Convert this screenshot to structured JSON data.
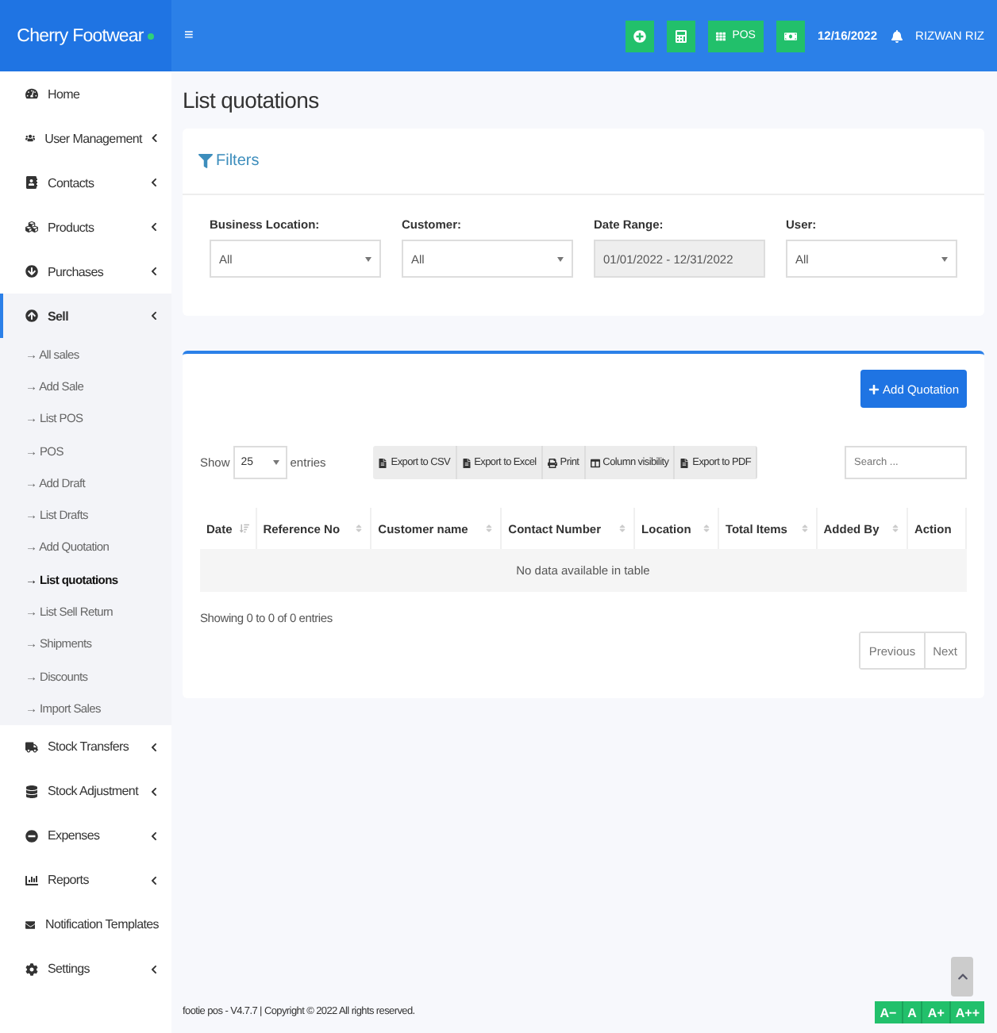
{
  "brand": {
    "name": "Cherry Footwear",
    "online": true
  },
  "header": {
    "menu_glyph": "≡",
    "pos_label": "POS",
    "date": "12/16/2022",
    "user": "RIZWAN RIZ"
  },
  "sidebar": {
    "items": [
      {
        "label": "Home",
        "has_children": false,
        "selected": false
      },
      {
        "label": "User Management",
        "has_children": true,
        "selected": false
      },
      {
        "label": "Contacts",
        "has_children": true,
        "selected": false
      },
      {
        "label": "Products",
        "has_children": true,
        "selected": false
      },
      {
        "label": "Purchases",
        "has_children": true,
        "selected": false
      },
      {
        "label": "Sell",
        "has_children": true,
        "selected": true,
        "children": [
          {
            "label": "→ All sales",
            "selected": false
          },
          {
            "label": "→ Add Sale",
            "selected": false
          },
          {
            "label": "→ List POS",
            "selected": false
          },
          {
            "label": "→ POS",
            "selected": false
          },
          {
            "label": "→ Add Draft",
            "selected": false
          },
          {
            "label": "→ List Drafts",
            "selected": false
          },
          {
            "label": "→ Add Quotation",
            "selected": false
          },
          {
            "label": "→ List quotations",
            "selected": true
          },
          {
            "label": "→ List Sell Return",
            "selected": false
          },
          {
            "label": "→ Shipments",
            "selected": false
          },
          {
            "label": "→ Discounts",
            "selected": false
          },
          {
            "label": "→ Import Sales",
            "selected": false
          }
        ]
      },
      {
        "label": "Stock Transfers",
        "has_children": true,
        "selected": false
      },
      {
        "label": "Stock Adjustment",
        "has_children": true,
        "selected": false
      },
      {
        "label": "Expenses",
        "has_children": true,
        "selected": false
      },
      {
        "label": "Reports",
        "has_children": true,
        "selected": false
      },
      {
        "label": "Notification Templates",
        "has_children": false,
        "selected": false
      },
      {
        "label": "Settings",
        "has_children": true,
        "selected": false
      }
    ]
  },
  "page_title": "List quotations",
  "filters": {
    "title": "Filters",
    "fields": [
      {
        "label": "Business Location:",
        "value": "All",
        "kind": "select"
      },
      {
        "label": "Customer:",
        "value": "All",
        "kind": "select"
      },
      {
        "label": "Date Range:",
        "value": "01/01/2022 - 12/31/2022",
        "kind": "readonly"
      },
      {
        "label": "User:",
        "value": "All",
        "kind": "select"
      }
    ]
  },
  "table_card": {
    "add_button": "Add Quotation",
    "show_label": "Show",
    "page_size": "25",
    "entries_label": "entries",
    "export_buttons": [
      "Export to CSV",
      "Export to Excel",
      "Print",
      "Column visibility",
      "Export to PDF"
    ],
    "search": {
      "placeholder": "Search ..."
    },
    "columns": [
      {
        "label": "Date",
        "sortable": true
      },
      {
        "label": "Reference No",
        "sortable": true
      },
      {
        "label": "Customer name",
        "sortable": true
      },
      {
        "label": "Contact Number",
        "sortable": true
      },
      {
        "label": "Location",
        "sortable": true
      },
      {
        "label": "Total Items",
        "sortable": true
      },
      {
        "label": "Added By",
        "sortable": true
      },
      {
        "label": "Action",
        "sortable": false
      }
    ],
    "empty_text": "No data available in table",
    "info": "Showing 0 to 0 of 0 entries",
    "pagination": [
      "Previous",
      "Next"
    ]
  },
  "footer": {
    "text": "footie pos - V4.7.7 | Copyright © 2022 All rights reserved.",
    "font_buttons": [
      "A−",
      "A",
      "A+",
      "A++"
    ]
  }
}
